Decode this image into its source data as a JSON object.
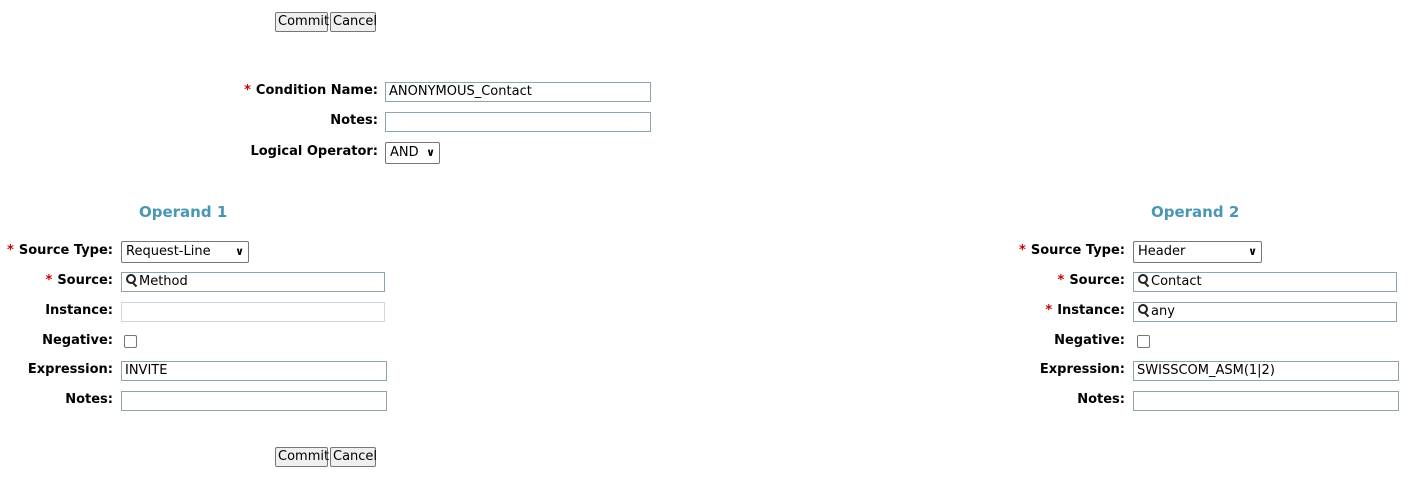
{
  "top_buttons": {
    "commit": "Commit",
    "cancel": "Cancel"
  },
  "condition": {
    "required_marker": "*",
    "name_label": "Condition Name:",
    "name_value": "ANONYMOUS_Contact",
    "notes_label": "Notes:",
    "notes_value": "",
    "logical_operator_label": "Logical Operator:",
    "logical_operator_value": "AND"
  },
  "operand1": {
    "title": "Operand 1",
    "source_type_label": "Source Type:",
    "source_type_value": "Request-Line",
    "source_label": "Source:",
    "source_value": "Method",
    "instance_label": "Instance:",
    "instance_value": "",
    "negative_label": "Negative:",
    "negative_checked": false,
    "expression_label": "Expression:",
    "expression_value": "INVITE",
    "notes_label": "Notes:",
    "notes_value": ""
  },
  "operand2": {
    "title": "Operand 2",
    "source_type_label": "Source Type:",
    "source_type_value": "Header",
    "source_label": "Source:",
    "source_value": "Contact",
    "instance_label": "Instance:",
    "instance_value": "any",
    "negative_label": "Negative:",
    "negative_checked": false,
    "expression_label": "Expression:",
    "expression_value": "SWISSCOM_ASM(1|2)",
    "notes_label": "Notes:",
    "notes_value": ""
  },
  "bottom_buttons": {
    "commit": "Commit",
    "cancel": "Cancel"
  },
  "icons": {
    "lookup": "magnifier-icon",
    "dropdown": "chevron-down-icon"
  },
  "colors": {
    "required": "#cc0000",
    "section_title": "#4a96b5",
    "input_border": "#8fa3ad"
  }
}
